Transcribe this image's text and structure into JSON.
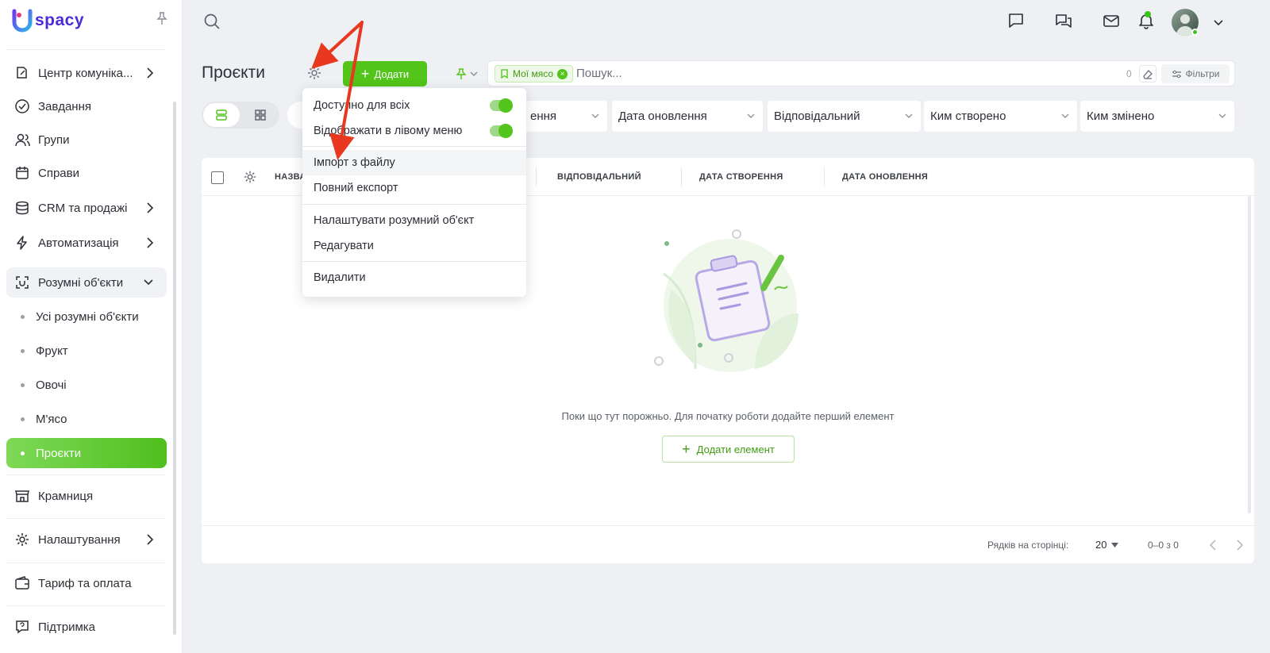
{
  "app": {
    "logo_text": "spacy",
    "brand_color": "#4b2bd6",
    "accent": "#52c41a"
  },
  "sidebar": {
    "items": [
      {
        "label": "Центр комуніка...",
        "icon": "edit-document-icon",
        "has_chevron": true
      },
      {
        "label": "Завдання",
        "icon": "check-circle-icon"
      },
      {
        "label": "Групи",
        "icon": "users-icon"
      },
      {
        "label": "Справи",
        "icon": "calendar-icon"
      },
      {
        "label": "CRM та продажі",
        "icon": "database-icon",
        "has_chevron": true
      },
      {
        "label": "Автоматизація",
        "icon": "lightning-icon",
        "has_chevron": true
      },
      {
        "label": "Розумні об'єкти",
        "icon": "scan-icon",
        "expanded": true
      },
      {
        "label": "Крамниця",
        "icon": "store-icon"
      },
      {
        "label": "Налаштування",
        "icon": "gear-icon",
        "has_chevron": true
      },
      {
        "label": "Тариф та оплата",
        "icon": "wallet-icon"
      },
      {
        "label": "Підтримка",
        "icon": "help-chat-icon"
      }
    ],
    "sub_items": [
      {
        "label": "Усі розумні об'єкти"
      },
      {
        "label": "Фрукт"
      },
      {
        "label": "Овочі"
      },
      {
        "label": "М'ясо"
      },
      {
        "label": "Проєкти",
        "active": true
      }
    ]
  },
  "header": {
    "title": "Проєкти",
    "add_button": "Додати",
    "filter_chip": "Мої мясо",
    "search_placeholder": "Пошук...",
    "count": "0",
    "filters_button": "Фільтри"
  },
  "filters": {
    "selects": [
      "ення",
      "Дата оновлення",
      "Відповідальний",
      "Ким створено",
      "Ким змінено"
    ]
  },
  "table": {
    "columns": [
      "НАЗВА",
      "ВІДПОВІДАЛЬНИЙ",
      "ДАТА СТВОРЕННЯ",
      "ДАТА ОНОВЛЕННЯ"
    ],
    "empty_text": "Поки що тут порожньо. Для початку роботи додайте перший елемент",
    "add_element": "Додати елемент",
    "rows_per_page_label": "Рядків на сторінці:",
    "rows_per_page": "20",
    "range": "0–0 з 0"
  },
  "menu": {
    "items": [
      {
        "label": "Доступно для всіх",
        "toggle": true
      },
      {
        "label": "Відображати в лівому меню",
        "toggle": true
      },
      {
        "label": "Імпорт з файлу"
      },
      {
        "label": "Повний експорт"
      },
      {
        "label": "Налаштувати розумний об'єкт"
      },
      {
        "label": "Редагувати"
      },
      {
        "label": "Видалити"
      }
    ]
  }
}
